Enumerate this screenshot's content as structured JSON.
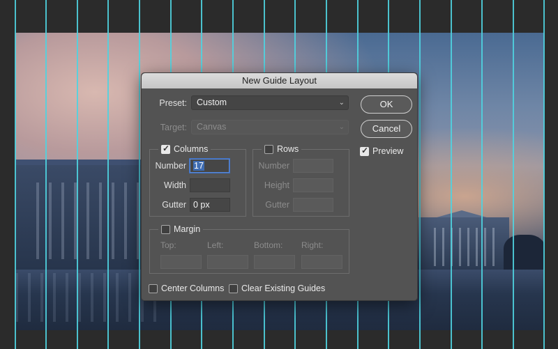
{
  "dialog": {
    "title": "New Guide Layout",
    "preset_label": "Preset:",
    "preset_value": "Custom",
    "target_label": "Target:",
    "target_value": "Canvas",
    "ok_label": "OK",
    "cancel_label": "Cancel",
    "preview_label": "Preview",
    "preview_checked": true,
    "columns": {
      "label": "Columns",
      "checked": true,
      "number_label": "Number",
      "number_value": "17",
      "width_label": "Width",
      "width_value": "",
      "gutter_label": "Gutter",
      "gutter_value": "0 px"
    },
    "rows": {
      "label": "Rows",
      "checked": false,
      "number_label": "Number",
      "height_label": "Height",
      "gutter_label": "Gutter"
    },
    "margin": {
      "label": "Margin",
      "checked": false,
      "top_label": "Top:",
      "left_label": "Left:",
      "bottom_label": "Bottom:",
      "right_label": "Right:"
    },
    "center_columns_label": "Center Columns",
    "clear_guides_label": "Clear Existing Guides"
  },
  "colors": {
    "guide": "#4fd3e0",
    "dialog_bg": "#535353",
    "focus": "#3e6fc0"
  }
}
